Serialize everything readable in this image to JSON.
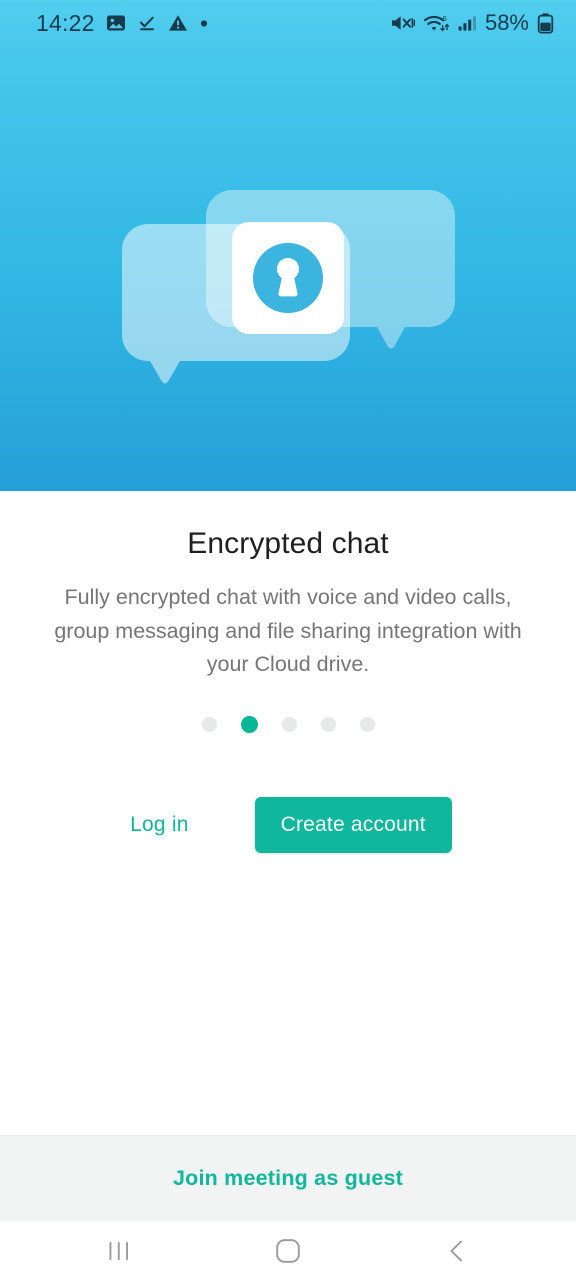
{
  "statusbar": {
    "time": "14:22",
    "battery_percent": "58%",
    "left_icons": [
      "image-icon",
      "download-complete-icon",
      "warning-triangle-icon",
      "dot-indicator-icon"
    ],
    "right_icons": [
      "mute-vibrate-icon",
      "wifi-6-icon",
      "cellular-signal-icon",
      "battery-icon"
    ],
    "text_color": "#143c4c"
  },
  "hero": {
    "gradient_top": "#51cdee",
    "gradient_bottom": "#259fd8",
    "illustration_name": "encrypted-chat-bubbles-lock-illustration",
    "bubble_back_color": "rgba(255,255,255,0.42)",
    "bubble_front_color": "rgba(255,255,255,0.55)",
    "card_color": "#ffffff",
    "lock_circle_color": "#3cb4e0",
    "keyhole_color": "#ffffff"
  },
  "main": {
    "title": "Encrypted chat",
    "description": "Fully encrypted chat with voice and video calls, group messaging and file sharing integration with your Cloud drive.",
    "title_color": "#1f1f1f",
    "description_color": "#767676"
  },
  "pager": {
    "total": 5,
    "active_index": 1,
    "active_color": "#04b795",
    "inactive_color": "#e7e8e8"
  },
  "actions": {
    "login_label": "Log in",
    "create_account_label": "Create account",
    "accent_color": "#0fb79c"
  },
  "footer": {
    "guest_label": "Join meeting as guest",
    "background": "#f2f3f3",
    "accent_color": "#0fb79c"
  },
  "navbar": {
    "recents_icon": "recents-icon",
    "home_icon": "home-icon",
    "back_icon": "back-chevron-icon",
    "icon_color": "#9a9a9a"
  }
}
